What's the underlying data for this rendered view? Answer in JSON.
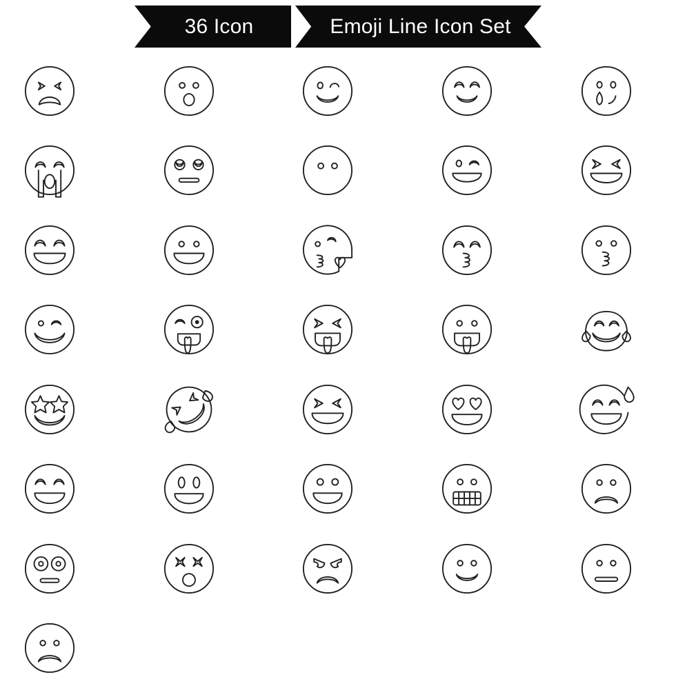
{
  "banner": {
    "left_label": "36 Icon",
    "right_label": "Emoji Line Icon Set",
    "background_color": "#0b0b0b",
    "text_color": "#ffffff"
  },
  "style": {
    "stroke_color": "#231f20",
    "background_color": "#ffffff",
    "stroke_width": "2.1"
  },
  "grid": {
    "columns": 5,
    "rows": 8,
    "total_icons": 36
  },
  "icons": [
    {
      "id": 1,
      "row": 1,
      "col": 1,
      "name": "distressed-face-x-eyes-icon",
      "label": "Weary face with X eyes and open frown"
    },
    {
      "id": 2,
      "row": 1,
      "col": 2,
      "name": "surprised-face-icon",
      "label": "Surprised face with round open mouth"
    },
    {
      "id": 3,
      "row": 1,
      "col": 3,
      "name": "winking-smile-icon",
      "label": "Winking face with smile"
    },
    {
      "id": 4,
      "row": 1,
      "col": 4,
      "name": "happy-face-arched-eyes-icon",
      "label": "Smiling face with arched eyes"
    },
    {
      "id": 5,
      "row": 1,
      "col": 5,
      "name": "crying-face-single-tear-icon",
      "label": "Sad face with single tear"
    },
    {
      "id": 6,
      "row": 2,
      "col": 1,
      "name": "sobbing-face-icon",
      "label": "Loudly crying face with double tears"
    },
    {
      "id": 7,
      "row": 2,
      "col": 2,
      "name": "eye-roll-face-icon",
      "label": "Face with rolling eyes and flat mouth"
    },
    {
      "id": 8,
      "row": 2,
      "col": 3,
      "name": "blank-face-icon",
      "label": "Blank face with two eyes, no mouth"
    },
    {
      "id": 9,
      "row": 2,
      "col": 4,
      "name": "winking-laugh-icon",
      "label": "Laughing face with one winking eye"
    },
    {
      "id": 10,
      "row": 2,
      "col": 5,
      "name": "laughing-x-eyes-icon",
      "label": "Laughing face with squinting X eyes"
    },
    {
      "id": 11,
      "row": 3,
      "col": 1,
      "name": "grinning-arched-eyes-icon",
      "label": "Grinning face with arched closed eyes"
    },
    {
      "id": 12,
      "row": 3,
      "col": 2,
      "name": "open-smile-icon",
      "label": "Grinning face with open smile"
    },
    {
      "id": 13,
      "row": 3,
      "col": 3,
      "name": "blowing-kiss-heart-icon",
      "label": "Face blowing a kiss with heart"
    },
    {
      "id": 14,
      "row": 3,
      "col": 4,
      "name": "kissing-closed-eyes-icon",
      "label": "Kissing face with closed arched eyes"
    },
    {
      "id": 15,
      "row": 3,
      "col": 5,
      "name": "kissing-face-icon",
      "label": "Kissing face with open eyes"
    },
    {
      "id": 16,
      "row": 4,
      "col": 1,
      "name": "winking-grin-icon",
      "label": "Winking face with big grin"
    },
    {
      "id": 17,
      "row": 4,
      "col": 2,
      "name": "zany-face-icon",
      "label": "Zany face with tongue out and winking eye"
    },
    {
      "id": 18,
      "row": 4,
      "col": 3,
      "name": "tongue-out-x-eyes-icon",
      "label": "Tongue out face with X eyes"
    },
    {
      "id": 19,
      "row": 4,
      "col": 4,
      "name": "tongue-out-face-icon",
      "label": "Face with tongue sticking out"
    },
    {
      "id": 20,
      "row": 4,
      "col": 5,
      "name": "tears-of-joy-icon",
      "label": "Face with tears of joy"
    },
    {
      "id": 21,
      "row": 5,
      "col": 1,
      "name": "star-struck-icon",
      "label": "Star-struck face with star eyes"
    },
    {
      "id": 22,
      "row": 5,
      "col": 2,
      "name": "rolling-on-floor-laughing-icon",
      "label": "Rolling on the floor laughing, tilted"
    },
    {
      "id": 23,
      "row": 5,
      "col": 3,
      "name": "laughing-squint-icon",
      "label": "Laughing face with squinted X eyes"
    },
    {
      "id": 24,
      "row": 5,
      "col": 4,
      "name": "heart-eyes-icon",
      "label": "Smiling face with heart eyes"
    },
    {
      "id": 25,
      "row": 5,
      "col": 5,
      "name": "grinning-sweat-drop-icon",
      "label": "Grinning face with sweat drop"
    },
    {
      "id": 26,
      "row": 6,
      "col": 1,
      "name": "beaming-face-icon",
      "label": "Beaming face with smiling eyes"
    },
    {
      "id": 27,
      "row": 6,
      "col": 2,
      "name": "grinning-oval-eyes-icon",
      "label": "Grinning face with oval eyes"
    },
    {
      "id": 28,
      "row": 6,
      "col": 3,
      "name": "grinning-round-eyes-icon",
      "label": "Grinning face with round eyes"
    },
    {
      "id": 29,
      "row": 6,
      "col": 4,
      "name": "grimacing-teeth-icon",
      "label": "Grimacing face with clenched teeth"
    },
    {
      "id": 30,
      "row": 6,
      "col": 5,
      "name": "frowning-face-icon",
      "label": "Frowning face with open frown"
    },
    {
      "id": 31,
      "row": 7,
      "col": 1,
      "name": "shocked-wide-eyes-icon",
      "label": "Shocked face with wide eyes and flat mouth"
    },
    {
      "id": 32,
      "row": 7,
      "col": 2,
      "name": "dizzy-x-eyes-icon",
      "label": "Dizzy face with X eyes and round mouth"
    },
    {
      "id": 33,
      "row": 7,
      "col": 3,
      "name": "angry-face-icon",
      "label": "Angry face with slanted brows"
    },
    {
      "id": 34,
      "row": 7,
      "col": 4,
      "name": "simple-smiley-icon",
      "label": "Simple smiley face"
    },
    {
      "id": 35,
      "row": 7,
      "col": 5,
      "name": "neutral-face-icon",
      "label": "Neutral face with straight mouth"
    },
    {
      "id": 36,
      "row": 8,
      "col": 1,
      "name": "sad-face-icon",
      "label": "Sad face with curved frown"
    }
  ]
}
